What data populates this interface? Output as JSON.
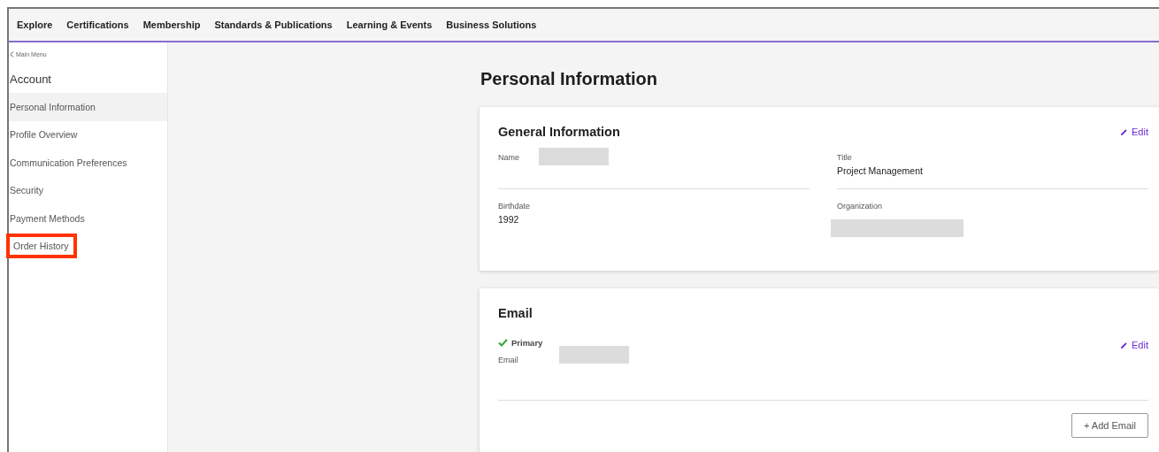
{
  "nav": [
    {
      "label": "Explore"
    },
    {
      "label": "Certifications"
    },
    {
      "label": "Membership"
    },
    {
      "label": "Standards & Publications"
    },
    {
      "label": "Learning & Events"
    },
    {
      "label": "Business Solutions"
    }
  ],
  "sidebar": {
    "back_link": "Main Menu",
    "heading": "Account",
    "items": [
      {
        "label": "Personal Information",
        "selected": true,
        "highlighted": false
      },
      {
        "label": "Profile Overview",
        "selected": false,
        "highlighted": false
      },
      {
        "label": "Communication Preferences",
        "selected": false,
        "highlighted": false
      },
      {
        "label": "Security",
        "selected": false,
        "highlighted": false
      },
      {
        "label": "Payment Methods",
        "selected": false,
        "highlighted": false
      },
      {
        "label": "Order History",
        "selected": false,
        "highlighted": true
      }
    ]
  },
  "page_title": "Personal Information",
  "general_information": {
    "title": "General Information",
    "edit": "Edit",
    "fields": [
      {
        "label": "Name",
        "redacted": true
      },
      {
        "label": "Title",
        "value": "Project Management"
      },
      {
        "label": "Birthdate",
        "value": "1992"
      },
      {
        "label": "Organization",
        "redacted": true
      }
    ]
  },
  "email": {
    "title": "Email",
    "primary": "Primary",
    "label": "Email",
    "redacted": true,
    "edit": "Edit",
    "add_button": "+ Add Email"
  }
}
